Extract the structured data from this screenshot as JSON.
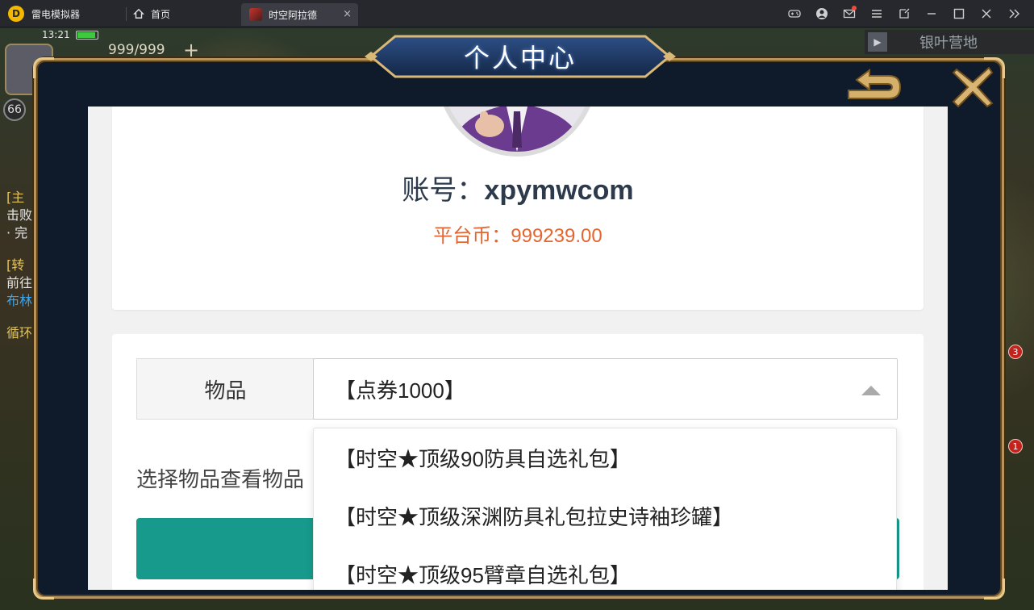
{
  "titlebar": {
    "app_name": "雷电模拟器",
    "home_tab": "首页",
    "game_tab": "时空阿拉德",
    "close_glyph": "×",
    "icons": [
      "gamepad-icon",
      "user-icon",
      "mail-icon",
      "menu-icon",
      "expand-icon",
      "minimize-icon",
      "maximize-icon",
      "close-icon",
      "more-icon"
    ]
  },
  "hud": {
    "time": "13:21",
    "resource": "999/999",
    "plus": "+",
    "level": "66",
    "location": "银叶营地",
    "quest_lines": [
      "[主",
      "击败",
      "· 完",
      "[转",
      "前往",
      "布林",
      "循环"
    ],
    "badges": [
      "3",
      "1"
    ]
  },
  "modal": {
    "title": "个人中心"
  },
  "profile": {
    "account_label": "账号：",
    "account_value": "xpymwcom",
    "coin_label": "平台币：",
    "coin_value": "999239.00"
  },
  "form": {
    "item_label": "物品",
    "selected_item": "【点券1000】",
    "hint": "选择物品查看物品",
    "options": [
      "【时空★顶级90防具自选礼包】",
      "【时空★顶级深渊防具礼包拉史诗袖珍罐】",
      "【时空★顶级95臂章自选礼包】"
    ]
  },
  "colors": {
    "accent_teal": "#179a8b",
    "coin_orange": "#e4652f",
    "modal_border_gold": "#b8945a"
  }
}
